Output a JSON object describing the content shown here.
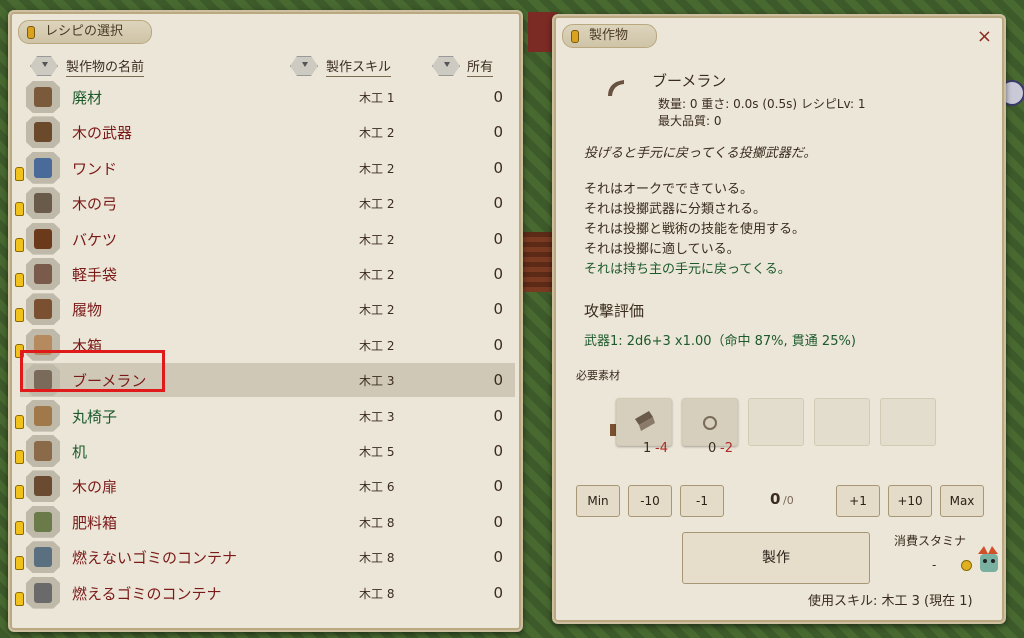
{
  "left": {
    "title": "レシピの選択",
    "headers": {
      "name": "製作物の名前",
      "skill": "製作スキル",
      "own": "所有"
    },
    "rows": [
      {
        "name": "廃材",
        "skill": "木工 1",
        "own": "0",
        "color": "green",
        "bulb": false,
        "icon": "scrap-wood-icon",
        "tint": "#7a5a3a"
      },
      {
        "name": "木の武器",
        "skill": "木工 2",
        "own": "0",
        "color": "dark",
        "bulb": false,
        "icon": "wooden-weapon-icon",
        "tint": "#6a4a2a"
      },
      {
        "name": "ワンド",
        "skill": "木工 2",
        "own": "0",
        "color": "dark",
        "bulb": true,
        "icon": "wand-icon",
        "tint": "#4a6a9a"
      },
      {
        "name": "木の弓",
        "skill": "木工 2",
        "own": "0",
        "color": "dark",
        "bulb": true,
        "icon": "bow-icon",
        "tint": "#6a5a4a"
      },
      {
        "name": "バケツ",
        "skill": "木工 2",
        "own": "0",
        "color": "dark",
        "bulb": true,
        "icon": "bucket-icon",
        "tint": "#6a3a1a"
      },
      {
        "name": "軽手袋",
        "skill": "木工 2",
        "own": "0",
        "color": "dark",
        "bulb": true,
        "icon": "glove-icon",
        "tint": "#7a5a4a"
      },
      {
        "name": "履物",
        "skill": "木工 2",
        "own": "0",
        "color": "dark",
        "bulb": true,
        "icon": "boots-icon",
        "tint": "#7a5030"
      },
      {
        "name": "木箱",
        "skill": "木工 2",
        "own": "0",
        "color": "dark",
        "bulb": true,
        "icon": "wooden-box-icon",
        "tint": "#b48a5e"
      },
      {
        "name": "ブーメラン",
        "skill": "木工 3",
        "own": "0",
        "color": "dark",
        "bulb": false,
        "icon": "boomerang-icon",
        "tint": "#7a6a5a",
        "selected": true
      },
      {
        "name": "丸椅子",
        "skill": "木工 3",
        "own": "0",
        "color": "green",
        "bulb": true,
        "icon": "stool-icon",
        "tint": "#a0784a"
      },
      {
        "name": "机",
        "skill": "木工 5",
        "own": "0",
        "color": "green",
        "bulb": true,
        "icon": "desk-icon",
        "tint": "#8a6a48"
      },
      {
        "name": "木の扉",
        "skill": "木工 6",
        "own": "0",
        "color": "dark",
        "bulb": true,
        "icon": "wooden-door-icon",
        "tint": "#6a4a30"
      },
      {
        "name": "肥料箱",
        "skill": "木工 8",
        "own": "0",
        "color": "dark",
        "bulb": true,
        "icon": "fertilizer-box-icon",
        "tint": "#6a7a48"
      },
      {
        "name": "燃えないゴミのコンテナ",
        "skill": "木工 8",
        "own": "0",
        "color": "dark",
        "bulb": true,
        "icon": "nonburnable-container-icon",
        "tint": "#5a7080"
      },
      {
        "name": "燃えるゴミのコンテナ",
        "skill": "木工 8",
        "own": "0",
        "color": "dark",
        "bulb": true,
        "icon": "burnable-container-icon",
        "tint": "#6a6a6a"
      }
    ]
  },
  "right": {
    "title": "製作物",
    "close": "×",
    "item": {
      "name": "ブーメラン",
      "stats": "数量: 0  重さ: 0.0s (0.5s)  レシピLv: 1",
      "quality": "最大品質: 0",
      "flavor": "投げると手元に戻ってくる投擲武器だ。",
      "lines": [
        "それはオークでできている。",
        "それは投擲武器に分類される。",
        "それは投擲と戦術の技能を使用する。",
        "それは投擲に適している。"
      ],
      "special": "それは持ち主の手元に戻ってくる。",
      "attack_title": "攻撃評価",
      "attack": "武器1: 2d6+3  x1.00（命中 87%, 貫通 25%)"
    },
    "materials": {
      "label": "必要素材",
      "slot1": {
        "have": "1",
        "need": "-4"
      },
      "slot2": {
        "have": "0",
        "need": "-2"
      }
    },
    "qty": {
      "min": "Min",
      "m10": "-10",
      "m1": "-1",
      "current": "0",
      "max_count": "/0",
      "p1": "+1",
      "p10": "+10",
      "max": "Max"
    },
    "craft": "製作",
    "stamina_label": "消費スタミナ",
    "stamina_val": "-",
    "skill_used": "使用スキル: 木工 3 (現在 1)"
  }
}
